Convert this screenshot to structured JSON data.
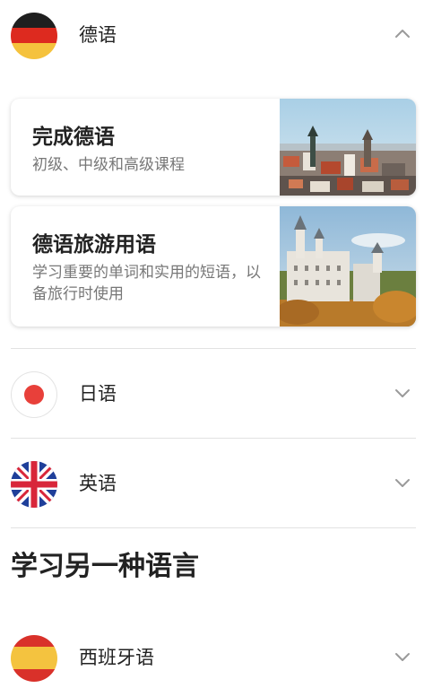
{
  "languages": {
    "german": {
      "name": "德语"
    },
    "japanese": {
      "name": "日语"
    },
    "english": {
      "name": "英语"
    }
  },
  "german_courses": [
    {
      "title": "完成德语",
      "subtitle": "初级、中级和高级课程"
    },
    {
      "title": "德语旅游用语",
      "subtitle": "学习重要的单词和实用的短语，以备旅行时使用"
    }
  ],
  "other_section": {
    "title": "学习另一种语言",
    "languages": [
      {
        "name": "西班牙语"
      }
    ]
  },
  "icons": {
    "expanded": "chevron-up-icon",
    "collapsed": "chevron-down-icon"
  },
  "colors": {
    "text": "#222222",
    "subtext": "#777777",
    "divider": "#e2e2e2",
    "chevron": "#9a9a9a"
  }
}
